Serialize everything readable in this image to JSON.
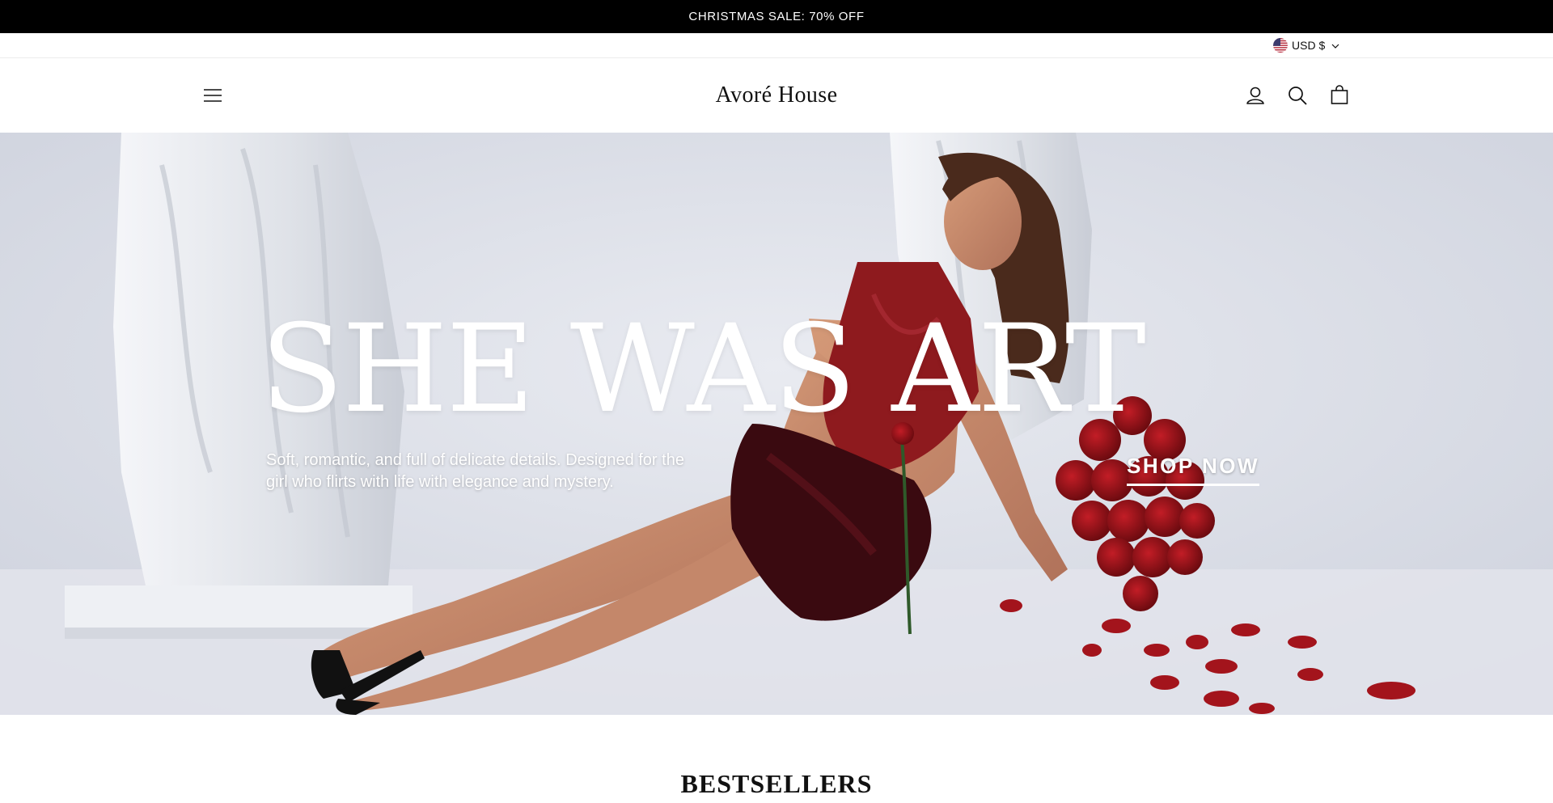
{
  "announcement": {
    "text": "CHRISTMAS SALE: 70% OFF"
  },
  "currency": {
    "label": "USD $",
    "flag_icon": "us-flag-icon"
  },
  "header": {
    "logo": "Avoré House",
    "icons": [
      "menu-icon",
      "account-icon",
      "search-icon",
      "cart-icon"
    ]
  },
  "hero": {
    "headline": "SHE WAS ART",
    "subtext": "Soft, romantic, and full of delicate details. Designed for the girl who flirts with life with elegance and mystery.",
    "cta": "SHOP NOW",
    "colors": {
      "dress": "#8e1a1e",
      "roses": "#a3141c",
      "background": "#dadde6"
    }
  },
  "sections": {
    "bestsellers_title": "BESTSELLERS"
  },
  "colors": {
    "announcement_bg": "#000000",
    "text": "#111111"
  }
}
